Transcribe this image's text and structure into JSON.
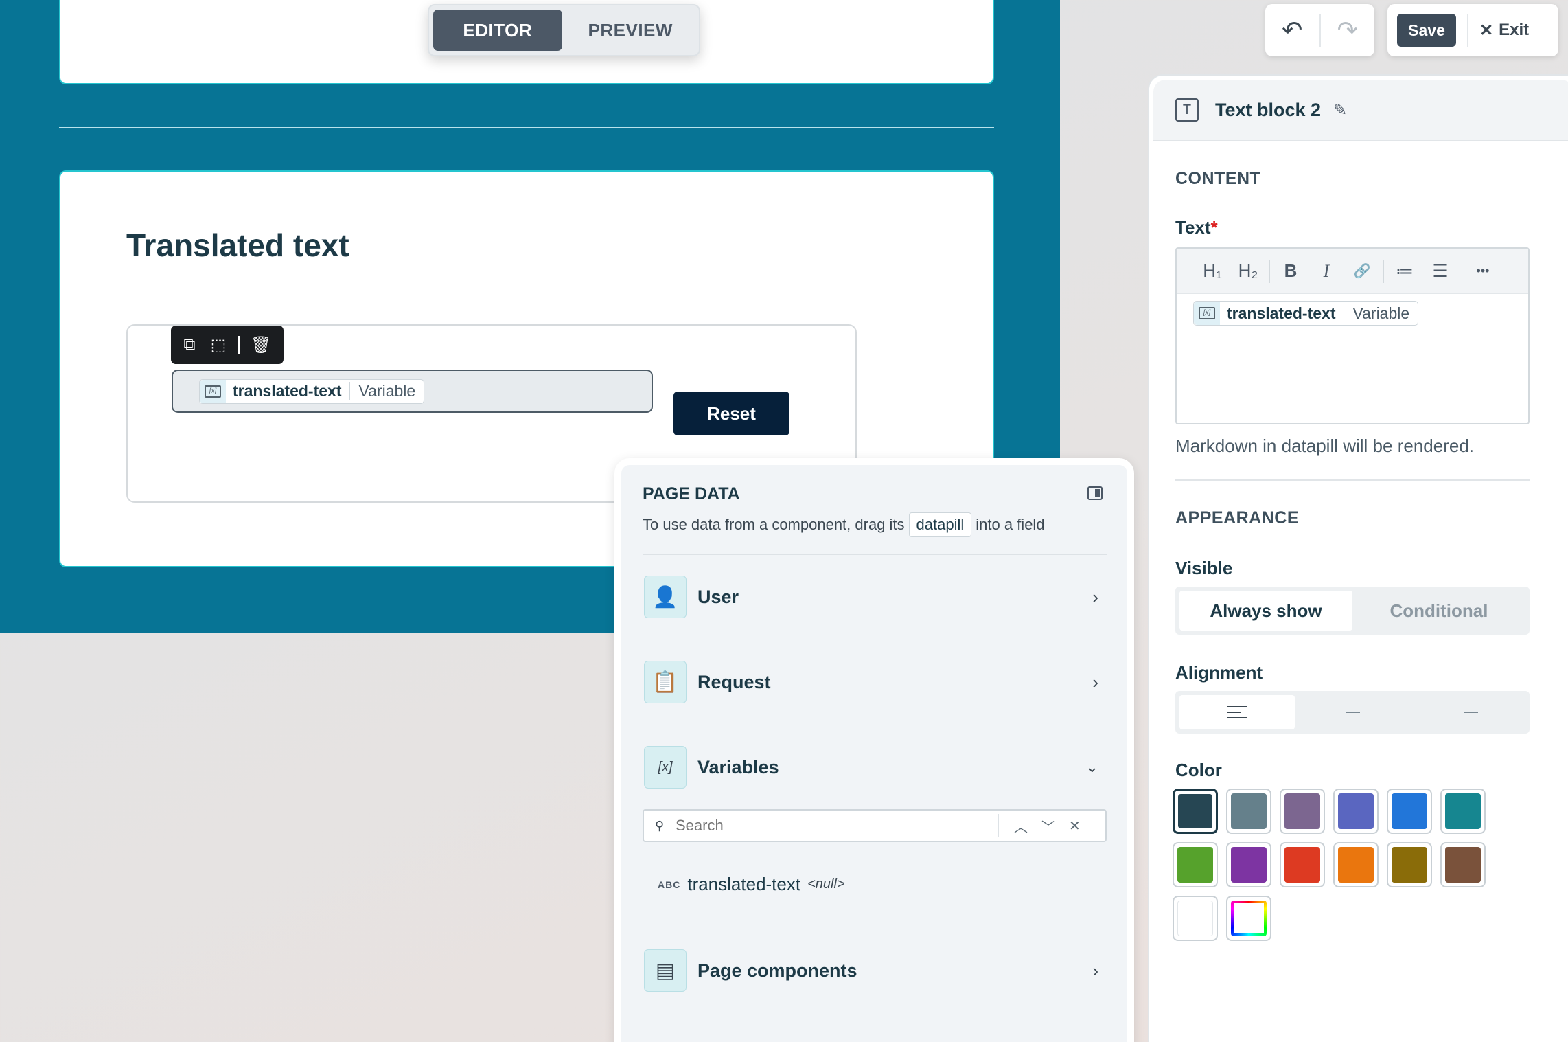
{
  "mode_toggle": {
    "editor": "EDITOR",
    "preview": "PREVIEW"
  },
  "canvas": {
    "heading": "Translated text",
    "datapill": {
      "name": "translated-text",
      "type": "Variable"
    },
    "reset_label": "Reset"
  },
  "toolbar": {
    "save_label": "Save",
    "exit_label": "Exit"
  },
  "properties": {
    "block_name": "Text block 2",
    "content_title": "CONTENT",
    "text_label": "Text",
    "required_mark": "*",
    "editor_toolbar": [
      "H₁",
      "H₂",
      "B",
      "I",
      "🔗",
      "≔",
      "☰",
      "•••"
    ],
    "editor_pill": {
      "name": "translated-text",
      "type": "Variable"
    },
    "help_text": "Markdown in datapill will be rendered.",
    "appearance_title": "APPEARANCE",
    "visible_label": "Visible",
    "visible_options": [
      "Always show",
      "Conditional"
    ],
    "visible_selected": "Always show",
    "alignment_label": "Alignment",
    "alignment_selected": "left",
    "color_label": "Color",
    "colors": [
      "#264653",
      "#65808b",
      "#7c6690",
      "#5a66c0",
      "#2276d9",
      "#168690",
      "#56a22c",
      "#7d34a2",
      "#dd3a22",
      "#ea760e",
      "#8a6c09",
      "#7a523b",
      "#ffffff",
      "custom"
    ],
    "color_selected": "#264653"
  },
  "page_data": {
    "title": "PAGE DATA",
    "desc_before": "To use data from a component, drag its",
    "desc_chip": "datapill",
    "desc_after": "into a field",
    "rows": [
      "User",
      "Request",
      "Variables",
      "Page components"
    ],
    "search_placeholder": "Search",
    "variable": {
      "type": "ABC",
      "name": "translated-text",
      "value": "<null>"
    }
  }
}
